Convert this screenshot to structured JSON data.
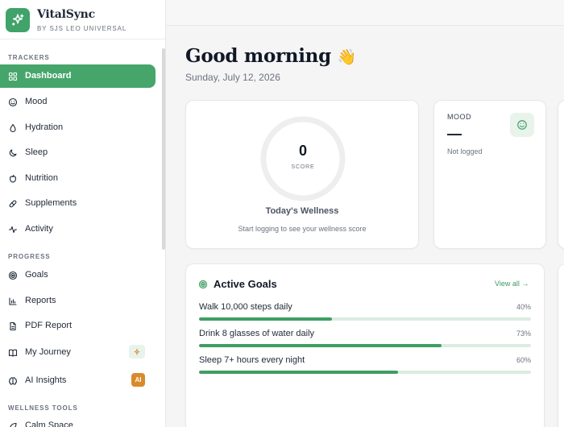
{
  "brand": {
    "name": "VitalSync",
    "subtitle": "BY SJS LEO UNIVERSAL"
  },
  "sidebar": {
    "sections": [
      {
        "label": "TRACKERS"
      },
      {
        "label": "PROGRESS"
      },
      {
        "label": "WELLNESS TOOLS"
      }
    ],
    "trackers": [
      {
        "label": "Dashboard",
        "icon": "grid-icon",
        "active": true
      },
      {
        "label": "Mood",
        "icon": "smile-icon"
      },
      {
        "label": "Hydration",
        "icon": "droplet-icon"
      },
      {
        "label": "Sleep",
        "icon": "moon-icon"
      },
      {
        "label": "Nutrition",
        "icon": "apple-icon"
      },
      {
        "label": "Supplements",
        "icon": "pill-icon"
      },
      {
        "label": "Activity",
        "icon": "pulse-icon"
      }
    ],
    "progress": [
      {
        "label": "Goals",
        "icon": "target-icon"
      },
      {
        "label": "Reports",
        "icon": "bar-chart-icon"
      },
      {
        "label": "PDF Report",
        "icon": "file-icon"
      },
      {
        "label": "My Journey",
        "icon": "book-icon",
        "badge": "sparkle-icon"
      },
      {
        "label": "AI Insights",
        "icon": "brain-icon",
        "badge_text": "AI"
      }
    ],
    "wellness": [
      {
        "label": "Calm Space",
        "icon": "leaf-icon"
      }
    ]
  },
  "header": {
    "greeting": "Good morning",
    "greeting_emoji": "👋",
    "date": "Sunday, July 12, 2026"
  },
  "wellness_card": {
    "score": "0",
    "score_label": "SCORE",
    "score_fraction": 0,
    "title": "Today's Wellness",
    "subtitle": "Start logging to see your wellness score"
  },
  "mood_card": {
    "title": "MOOD",
    "value": "—",
    "status": "Not logged",
    "icon": "smile-icon"
  },
  "goals_card": {
    "title": "Active Goals",
    "view_all": "View all →",
    "goals": [
      {
        "name": "Walk 10,000 steps daily",
        "pct_text": "40%",
        "progress": 0.4
      },
      {
        "name": "Drink 8 glasses of water daily",
        "pct_text": "73%",
        "progress": 0.73
      },
      {
        "name": "Sleep 7+ hours every night",
        "pct_text": "60%",
        "progress": 0.6
      }
    ]
  },
  "colors": {
    "accent": "#46a56b",
    "accent_light": "#e8f3ec",
    "ai_badge": "#d98b2b",
    "progress_track": "#dbece2"
  }
}
